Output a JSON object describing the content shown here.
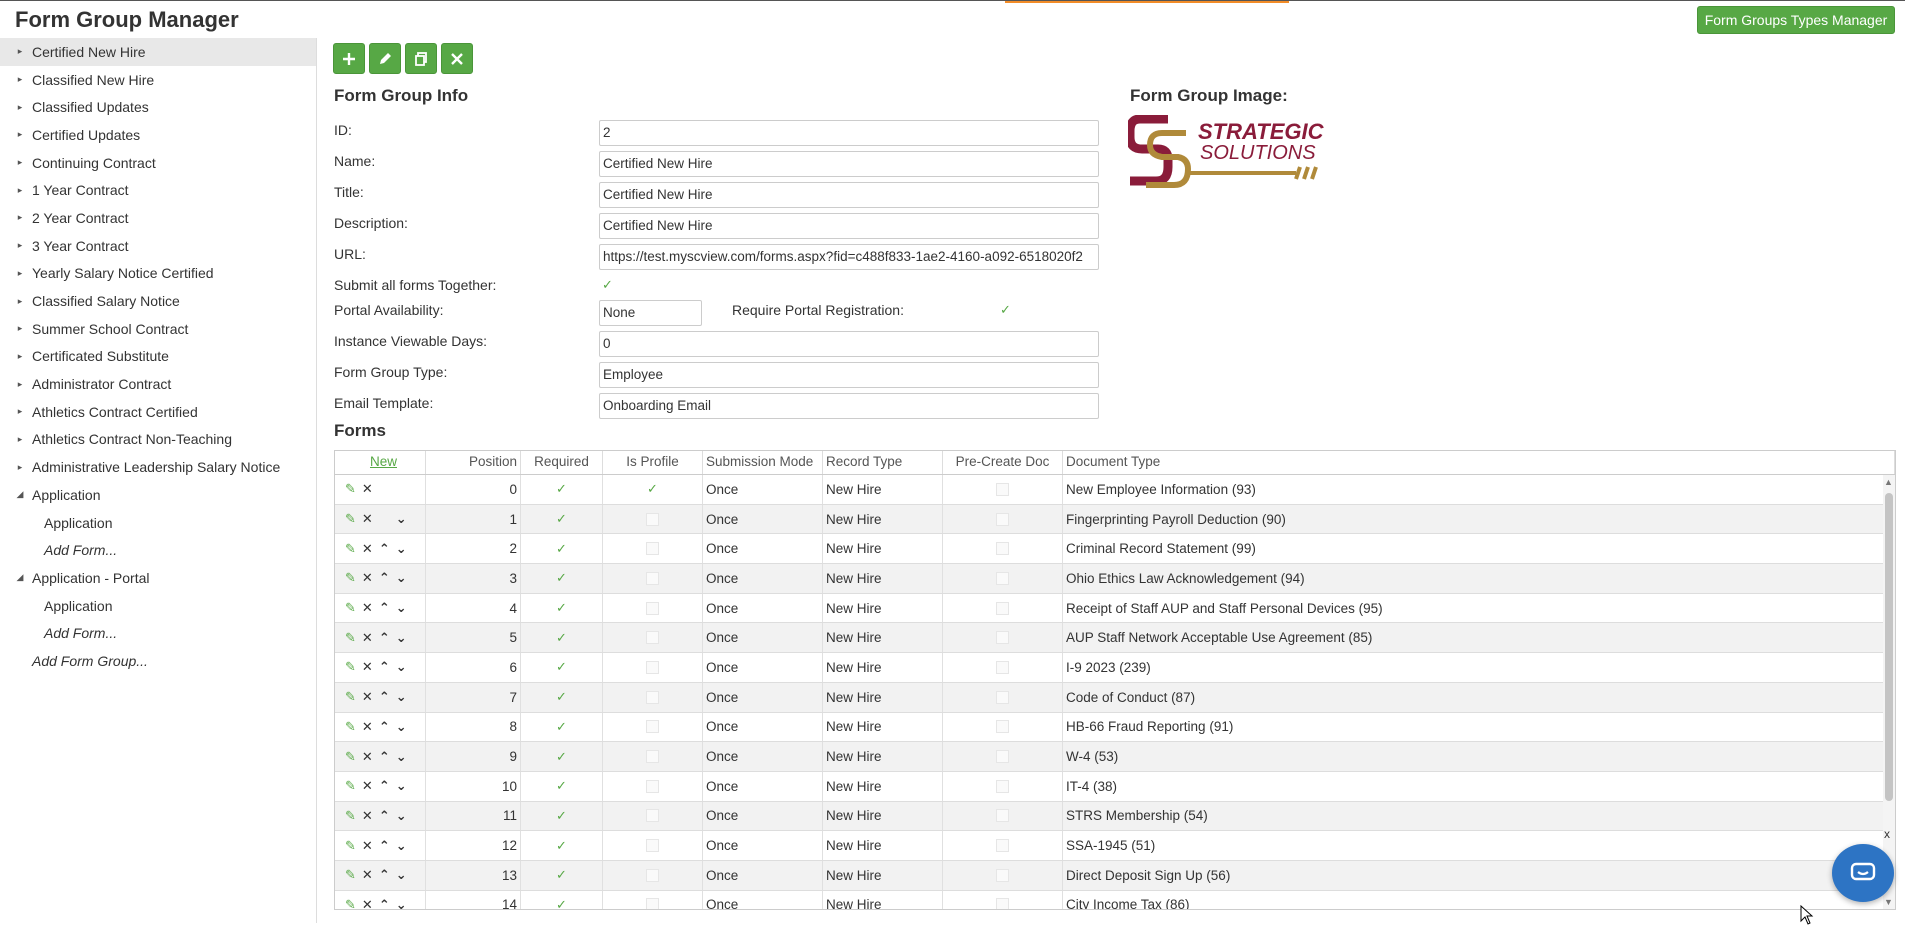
{
  "app": {
    "title": "Form Group Manager",
    "types_button": "Form Groups Types Manager"
  },
  "colors": {
    "accent": "#57a845",
    "highlight": "#f28c28",
    "chat": "#2d74c4"
  },
  "sidebar": {
    "items": [
      {
        "label": "Certified New Hire",
        "selected": true
      },
      {
        "label": "Classified New Hire"
      },
      {
        "label": "Classified Updates"
      },
      {
        "label": "Certified Updates"
      },
      {
        "label": "Continuing Contract"
      },
      {
        "label": "1 Year Contract"
      },
      {
        "label": "2 Year Contract"
      },
      {
        "label": "3 Year Contract"
      },
      {
        "label": "Yearly Salary Notice Certified"
      },
      {
        "label": "Classified Salary Notice"
      },
      {
        "label": "Summer School Contract"
      },
      {
        "label": "Certificated Substitute"
      },
      {
        "label": "Administrator Contract"
      },
      {
        "label": "Athletics Contract Certified"
      },
      {
        "label": "Athletics Contract Non-Teaching"
      },
      {
        "label": "Administrative Leadership Salary Notice"
      },
      {
        "label": "Application",
        "expanded": true
      },
      {
        "label": "Application",
        "child": true
      },
      {
        "label": "Add Form...",
        "child": true,
        "add": true
      },
      {
        "label": "Application - Portal",
        "expanded": true
      },
      {
        "label": "Application",
        "child": true
      },
      {
        "label": "Add Form...",
        "child": true,
        "add": true
      }
    ],
    "add_group": "Add Form Group..."
  },
  "toolbar": {
    "add_icon": "plus-icon",
    "edit_icon": "pencil-icon",
    "copy_icon": "copy-icon",
    "delete_icon": "close-icon"
  },
  "info": {
    "title": "Form Group Info",
    "image_title": "Form Group Image:",
    "id_label": "ID:",
    "id_value": "2",
    "name_label": "Name:",
    "name_value": "Certified New Hire",
    "title_label": "Title:",
    "title_value": "Certified New Hire",
    "desc_label": "Description:",
    "desc_value": "Certified New Hire",
    "url_label": "URL:",
    "url_value": "https://test.myscview.com/forms.aspx?fid=c488f833-1ae2-4160-a092-6518020f2",
    "submit_label": "Submit all forms Together:",
    "portal_label": "Portal Availability:",
    "portal_value": "None",
    "require_label": "Require Portal Registration:",
    "days_label": "Instance Viewable Days:",
    "days_value": "0",
    "type_label": "Form Group Type:",
    "type_value": "Employee",
    "email_label": "Email Template:",
    "email_value": "Onboarding Email"
  },
  "logo": {
    "line1": "STRATEGIC",
    "line2": "SOLUTIONS"
  },
  "forms": {
    "title": "Forms",
    "headers": {
      "new": "New",
      "position": "Position",
      "required": "Required",
      "is_profile": "Is Profile",
      "mode": "Submission Mode",
      "record": "Record Type",
      "precreate": "Pre-Create Doc",
      "doc": "Document Type"
    },
    "rows": [
      {
        "pos": "0",
        "profile": true,
        "mode": "Once",
        "record": "New Hire",
        "doc": "New Employee Information (93)"
      },
      {
        "pos": "1",
        "profile": false,
        "mode": "Once",
        "record": "New Hire",
        "doc": "Fingerprinting Payroll Deduction (90)"
      },
      {
        "pos": "2",
        "profile": false,
        "mode": "Once",
        "record": "New Hire",
        "doc": "Criminal Record Statement (99)"
      },
      {
        "pos": "3",
        "profile": false,
        "mode": "Once",
        "record": "New Hire",
        "doc": "Ohio Ethics Law Acknowledgement (94)"
      },
      {
        "pos": "4",
        "profile": false,
        "mode": "Once",
        "record": "New Hire",
        "doc": "Receipt of Staff AUP and Staff Personal Devices (95)"
      },
      {
        "pos": "5",
        "profile": false,
        "mode": "Once",
        "record": "New Hire",
        "doc": "AUP Staff Network Acceptable Use Agreement (85)"
      },
      {
        "pos": "6",
        "profile": false,
        "mode": "Once",
        "record": "New Hire",
        "doc": "I-9 2023 (239)"
      },
      {
        "pos": "7",
        "profile": false,
        "mode": "Once",
        "record": "New Hire",
        "doc": "Code of Conduct (87)"
      },
      {
        "pos": "8",
        "profile": false,
        "mode": "Once",
        "record": "New Hire",
        "doc": "HB-66 Fraud Reporting (91)"
      },
      {
        "pos": "9",
        "profile": false,
        "mode": "Once",
        "record": "New Hire",
        "doc": "W-4 (53)"
      },
      {
        "pos": "10",
        "profile": false,
        "mode": "Once",
        "record": "New Hire",
        "doc": "IT-4 (38)"
      },
      {
        "pos": "11",
        "profile": false,
        "mode": "Once",
        "record": "New Hire",
        "doc": "STRS Membership (54)"
      },
      {
        "pos": "12",
        "profile": false,
        "mode": "Once",
        "record": "New Hire",
        "doc": "SSA-1945 (51)"
      },
      {
        "pos": "13",
        "profile": false,
        "mode": "Once",
        "record": "New Hire",
        "doc": "Direct Deposit Sign Up (56)"
      },
      {
        "pos": "14",
        "profile": false,
        "mode": "Once",
        "record": "New Hire",
        "doc": "City Income Tax (86)"
      }
    ]
  },
  "chat": {
    "close": "x"
  }
}
